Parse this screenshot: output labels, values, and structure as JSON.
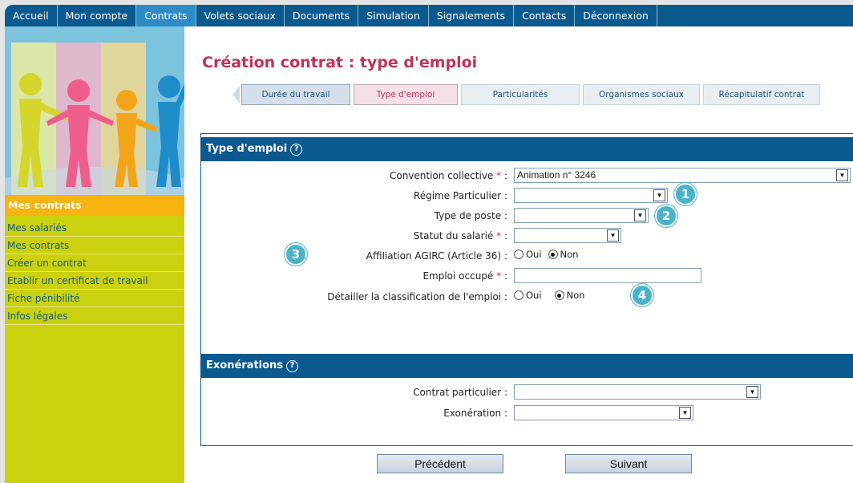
{
  "nav": {
    "items": [
      {
        "label": "Accueil"
      },
      {
        "label": "Mon compte"
      },
      {
        "label": "Contrats"
      },
      {
        "label": "Volets sociaux"
      },
      {
        "label": "Documents"
      },
      {
        "label": "Simulation"
      },
      {
        "label": "Signalements"
      },
      {
        "label": "Contacts"
      },
      {
        "label": "Déconnexion"
      }
    ],
    "active": "Contrats",
    "color": "#0b5a8f",
    "active_color": "#2d8cc6"
  },
  "sidebar": {
    "title": "Mes contrats",
    "links": [
      {
        "label": "Mes salariés"
      },
      {
        "label": "Mes contrats"
      },
      {
        "label": "Créer un contrat"
      },
      {
        "label": "Etablir un certificat de travail"
      },
      {
        "label": "Fiche pénibilité"
      },
      {
        "label": "Infos légales"
      }
    ],
    "color": "#cbd10f",
    "title_color": "#f7b30f"
  },
  "page": {
    "title": "Création contrat : type d'emploi",
    "title_color": "#c0325a"
  },
  "wizard": {
    "steps": [
      {
        "label": "Durée du travail"
      },
      {
        "label": "Type d'emploi"
      },
      {
        "label": "Particularités"
      },
      {
        "label": "Organismes sociaux"
      },
      {
        "label": "Récapitulatif contrat"
      }
    ],
    "current": "Type d'emploi"
  },
  "type_emploi": {
    "header": "Type d'emploi",
    "convention": {
      "label": "Convention collective",
      "required": "*",
      "colon": ":",
      "value": "Animation n° 3246"
    },
    "regime": {
      "label": "Régime Particulier",
      "colon": ":",
      "value": ""
    },
    "type_poste": {
      "label": "Type de poste",
      "colon": ":",
      "value": ""
    },
    "statut": {
      "label": "Statut du salarié",
      "required": "*",
      "colon": ":",
      "value": ""
    },
    "affiliation": {
      "label": "Affiliation AGIRC (Article 36)",
      "colon": ":",
      "options": [
        "Oui",
        "Non"
      ],
      "selected": "Non"
    },
    "emploi": {
      "label": "Emploi occupé",
      "required": "*",
      "colon": ":",
      "value": ""
    },
    "detailler": {
      "label": "Détailler la classification de l'emploi",
      "colon": ":",
      "options": [
        "Oui",
        "Non"
      ],
      "selected": "Non"
    }
  },
  "exonerations": {
    "header": "Exonérations",
    "contrat": {
      "label": "Contrat particulier",
      "colon": ":",
      "value": ""
    },
    "exoneration": {
      "label": "Exonération",
      "colon": ":",
      "value": ""
    }
  },
  "badges": [
    "1",
    "2",
    "3",
    "4"
  ],
  "badge_color": "#4bb3c8",
  "buttons": {
    "previous": "Précédent",
    "next": "Suivant"
  },
  "icons": {
    "help": "help-circle-icon",
    "dropdown": "chevron-down-icon",
    "required": "asterisk-icon"
  }
}
